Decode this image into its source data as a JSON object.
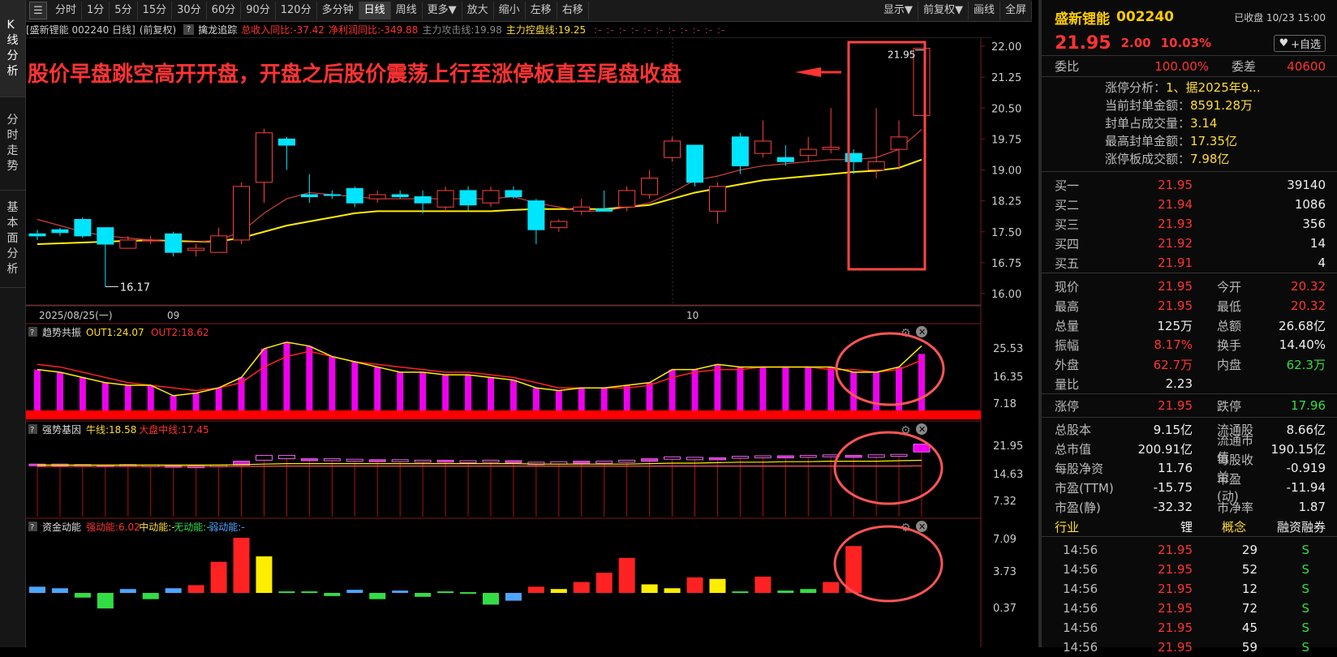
{
  "sidebar": {
    "tabs": [
      "K线分析",
      "分时走势",
      "基本面分析"
    ]
  },
  "toolbar": {
    "periods": [
      "分时",
      "1分",
      "5分",
      "15分",
      "30分",
      "60分",
      "90分",
      "120分",
      "多分钟",
      "日线",
      "周线",
      "更多▼",
      "放大",
      "缩小",
      "左移",
      "右移"
    ],
    "active_period": "日线",
    "right": [
      "显示▼",
      "前复权▼",
      "画线",
      "全屏"
    ]
  },
  "main_info": {
    "title": "[盛新锂能 002240 日线]",
    "adjust": "(前复权)",
    "indicator": "擒龙追踪",
    "items": [
      {
        "text": "总收入同比:-37.42",
        "color": "#ff3333"
      },
      {
        "text": "净利润同比:-349.88",
        "color": "#ff3333"
      },
      {
        "text": "主力攻击线:19.98",
        "color": "#888888"
      },
      {
        "text": "主力控盘线:19.25",
        "color": "#ffdd33"
      }
    ],
    "dots": ":- :- :- :- :- :- :- :- :- :- :-"
  },
  "annotation": {
    "text": "股价早盘跳空高开开盘，开盘之后股价震荡上行至涨停板直至尾盘收盘",
    "color": "#ff3333"
  },
  "price_axis": {
    "ticks": [
      "22.00",
      "21.25",
      "20.50",
      "19.75",
      "19.00",
      "18.25",
      "17.50",
      "16.75",
      "16.00"
    ]
  },
  "date_axis": {
    "labels": [
      "2025/08/25(一)",
      "09",
      "10"
    ]
  },
  "marks": {
    "high": "21.95",
    "low": "16.17"
  },
  "panels": [
    {
      "title": "趋势共振",
      "items": [
        {
          "text": "OUT1:24.07",
          "color": "#ffdd33"
        },
        {
          "text": "OUT2:18.62",
          "color": "#ff3333"
        }
      ],
      "ticks": [
        "25.53",
        "16.35",
        "7.18"
      ]
    },
    {
      "title": "强势基因",
      "items": [
        {
          "text": "牛线:18.58",
          "color": "#ffdd33"
        },
        {
          "text": "大盘中线:17.45",
          "color": "#ff3333"
        }
      ],
      "ticks": [
        "21.95",
        "14.63",
        "7.32"
      ]
    },
    {
      "title": "资金动能",
      "items": [
        {
          "text": "强动能:6.02",
          "color": "#ff3333"
        },
        {
          "text": "中动能:-",
          "color": "#ffdd33"
        },
        {
          "text": "无动能:-",
          "color": "#33dd44"
        },
        {
          "text": "弱动能:-",
          "color": "#4da6ff"
        }
      ],
      "ticks": [
        "7.09",
        "3.73",
        "0.37"
      ]
    }
  ],
  "chart_data": {
    "type": "candlestick",
    "candles": [
      [
        17.45,
        17.4,
        17.55,
        17.3
      ],
      [
        17.55,
        17.48,
        17.6,
        17.4
      ],
      [
        17.8,
        17.4,
        17.85,
        17.35
      ],
      [
        17.6,
        17.2,
        17.6,
        16.17
      ],
      [
        17.1,
        17.3,
        17.4,
        17.1
      ],
      [
        17.3,
        17.3,
        17.4,
        17.2
      ],
      [
        17.45,
        17.0,
        17.5,
        16.9
      ],
      [
        17.05,
        17.1,
        17.2,
        16.9
      ],
      [
        17.0,
        17.4,
        17.6,
        17.0
      ],
      [
        17.3,
        18.6,
        18.7,
        17.2
      ],
      [
        18.7,
        19.9,
        20.0,
        18.2
      ],
      [
        19.75,
        19.6,
        19.8,
        19.0
      ],
      [
        18.4,
        18.35,
        18.9,
        18.2
      ],
      [
        18.4,
        18.38,
        18.5,
        18.3
      ],
      [
        18.55,
        18.2,
        18.6,
        18.1
      ],
      [
        18.3,
        18.4,
        18.5,
        18.2
      ],
      [
        18.4,
        18.35,
        18.5,
        18.3
      ],
      [
        18.35,
        18.2,
        18.5,
        17.95
      ],
      [
        18.1,
        18.5,
        18.6,
        18.0
      ],
      [
        18.5,
        18.15,
        18.6,
        18.0
      ],
      [
        18.2,
        18.5,
        18.6,
        18.1
      ],
      [
        18.5,
        18.35,
        18.6,
        18.3
      ],
      [
        18.25,
        17.55,
        18.3,
        17.2
      ],
      [
        17.6,
        17.75,
        17.8,
        17.5
      ],
      [
        18.0,
        18.1,
        18.3,
        17.9
      ],
      [
        18.05,
        18.0,
        18.5,
        18.0
      ],
      [
        18.1,
        18.5,
        18.6,
        18.0
      ],
      [
        18.4,
        18.8,
        19.0,
        18.3
      ],
      [
        19.3,
        19.7,
        19.8,
        19.2
      ],
      [
        19.6,
        18.7,
        19.6,
        18.6
      ],
      [
        18.0,
        18.6,
        18.7,
        17.7
      ],
      [
        19.8,
        19.1,
        19.9,
        18.9
      ],
      [
        19.4,
        19.7,
        20.2,
        19.3
      ],
      [
        19.3,
        19.2,
        19.6,
        19.1
      ],
      [
        19.35,
        19.5,
        19.8,
        19.2
      ],
      [
        19.5,
        19.55,
        20.5,
        19.4
      ],
      [
        19.4,
        19.2,
        19.5,
        18.9
      ],
      [
        19.0,
        19.2,
        20.5,
        18.8
      ],
      [
        19.5,
        19.8,
        20.2,
        19.0
      ],
      [
        20.32,
        21.95,
        21.95,
        20.32
      ]
    ],
    "ma_short": [
      17.8,
      17.65,
      17.5,
      17.4,
      17.35,
      17.3,
      17.25,
      17.25,
      17.3,
      17.5,
      17.95,
      18.3,
      18.45,
      18.4,
      18.35,
      18.3,
      18.3,
      18.3,
      18.3,
      18.3,
      18.3,
      18.35,
      18.2,
      18.1,
      18.0,
      18.0,
      18.1,
      18.2,
      18.45,
      18.75,
      18.85,
      19.0,
      19.1,
      19.15,
      19.2,
      19.25,
      19.25,
      19.3,
      19.5,
      19.98
    ],
    "ma_long": [
      17.2,
      17.22,
      17.24,
      17.26,
      17.28,
      17.29,
      17.28,
      17.26,
      17.27,
      17.35,
      17.5,
      17.65,
      17.75,
      17.85,
      17.95,
      18.0,
      18.0,
      18.0,
      18.0,
      18.0,
      18.0,
      18.03,
      18.05,
      18.05,
      18.05,
      18.05,
      18.1,
      18.15,
      18.3,
      18.45,
      18.55,
      18.65,
      18.75,
      18.8,
      18.85,
      18.9,
      18.95,
      18.98,
      19.05,
      19.25
    ],
    "resonance_bars": [
      15,
      14,
      12,
      10,
      9,
      9,
      5,
      6,
      8,
      12,
      23,
      25.5,
      24,
      20,
      18,
      16,
      14,
      14,
      13,
      13,
      12,
      11,
      8,
      7,
      8,
      8,
      9,
      10,
      15,
      15,
      17,
      16,
      16,
      16,
      16,
      16,
      14,
      14,
      16,
      21
    ],
    "resonance_out1": [
      15,
      14,
      12,
      10,
      9,
      9,
      5,
      6,
      8,
      12,
      23,
      25.5,
      24,
      20,
      18,
      16,
      14,
      14,
      13,
      13,
      12,
      11,
      8,
      7,
      8,
      8,
      9,
      10,
      15,
      15,
      17,
      16,
      16,
      16,
      16,
      16,
      14,
      14,
      16,
      24.07
    ],
    "resonance_out2": [
      17,
      16,
      14,
      12,
      10,
      9,
      8,
      7,
      8,
      10,
      16,
      20,
      22,
      20,
      18,
      17,
      16,
      15,
      14,
      14,
      13,
      12,
      10,
      8,
      8,
      8,
      8,
      9,
      12,
      14,
      15,
      15,
      16,
      16,
      16,
      15,
      15,
      14,
      15,
      18.62
    ],
    "gene_bars": [
      [
        17.5,
        17.8
      ],
      [
        17.5,
        17.8
      ],
      [
        17.4,
        17.7
      ],
      [
        17.3,
        17.6
      ],
      [
        17.4,
        17.7
      ],
      [
        17.3,
        17.6
      ],
      [
        17.2,
        17.5
      ],
      [
        17.2,
        17.4
      ],
      [
        17.3,
        17.6
      ],
      [
        17.6,
        18.4
      ],
      [
        18.6,
        19.6
      ],
      [
        18.9,
        19.6
      ],
      [
        18.5,
        18.9
      ],
      [
        18.5,
        18.9
      ],
      [
        18.4,
        18.8
      ],
      [
        18.3,
        18.7
      ],
      [
        18.3,
        18.7
      ],
      [
        18.2,
        18.6
      ],
      [
        18.2,
        18.6
      ],
      [
        18.1,
        18.5
      ],
      [
        18.2,
        18.6
      ],
      [
        18.1,
        18.5
      ],
      [
        17.7,
        18.2
      ],
      [
        17.8,
        18.3
      ],
      [
        18.0,
        18.4
      ],
      [
        18.0,
        18.4
      ],
      [
        18.2,
        18.6
      ],
      [
        18.4,
        18.9
      ],
      [
        18.8,
        19.3
      ],
      [
        18.7,
        19.2
      ],
      [
        18.7,
        19.1
      ],
      [
        19.0,
        19.4
      ],
      [
        19.1,
        19.5
      ],
      [
        19.1,
        19.5
      ],
      [
        19.2,
        19.6
      ],
      [
        19.3,
        19.7
      ],
      [
        19.2,
        19.6
      ],
      [
        19.2,
        19.7
      ],
      [
        19.4,
        19.8
      ],
      [
        20.3,
        21.9
      ]
    ],
    "gene_line1": [
      17.6,
      17.6,
      17.6,
      17.6,
      17.6,
      17.6,
      17.6,
      17.6,
      17.6,
      17.7,
      17.8,
      17.9,
      17.9,
      17.9,
      17.9,
      17.9,
      17.9,
      17.9,
      17.9,
      17.9,
      17.9,
      17.9,
      17.8,
      17.8,
      17.8,
      17.8,
      17.8,
      17.9,
      18.0,
      18.0,
      18.1,
      18.2,
      18.2,
      18.3,
      18.3,
      18.4,
      18.4,
      18.4,
      18.5,
      18.58
    ],
    "gene_line2": [
      17.3,
      17.3,
      17.3,
      17.3,
      17.3,
      17.3,
      17.3,
      17.3,
      17.3,
      17.3,
      17.35,
      17.4,
      17.4,
      17.4,
      17.4,
      17.4,
      17.4,
      17.4,
      17.4,
      17.4,
      17.4,
      17.4,
      17.4,
      17.4,
      17.4,
      17.4,
      17.4,
      17.4,
      17.4,
      17.4,
      17.4,
      17.4,
      17.4,
      17.4,
      17.4,
      17.4,
      17.4,
      17.4,
      17.4,
      17.45
    ],
    "fund_bars": [
      [
        0.8,
        "#4da6ff"
      ],
      [
        0.6,
        "#4da6ff"
      ],
      [
        -0.6,
        "#33dd44"
      ],
      [
        -2,
        "#33dd44"
      ],
      [
        0.5,
        "#4da6ff"
      ],
      [
        -0.8,
        "#33dd44"
      ],
      [
        0.6,
        "#4da6ff"
      ],
      [
        1.0,
        "#ff2222"
      ],
      [
        4.0,
        "#ff2222"
      ],
      [
        7.09,
        "#ff2222"
      ],
      [
        4.7,
        "#ffee00"
      ],
      [
        0.2,
        "#33dd44"
      ],
      [
        0.2,
        "#33dd44"
      ],
      [
        -0.4,
        "#33dd44"
      ],
      [
        0.4,
        "#4da6ff"
      ],
      [
        -0.8,
        "#33dd44"
      ],
      [
        0.3,
        "#4da6ff"
      ],
      [
        -0.5,
        "#33dd44"
      ],
      [
        0.2,
        "#33dd44"
      ],
      [
        0.1,
        "#33dd44"
      ],
      [
        -1.5,
        "#33dd44"
      ],
      [
        -1.0,
        "#4da6ff"
      ],
      [
        0.8,
        "#ff2222"
      ],
      [
        0.5,
        "#ffee00"
      ],
      [
        1.4,
        "#ff2222"
      ],
      [
        2.6,
        "#ff2222"
      ],
      [
        4.5,
        "#ff2222"
      ],
      [
        1.1,
        "#ffee00"
      ],
      [
        0.6,
        "#ffee00"
      ],
      [
        2.0,
        "#ff2222"
      ],
      [
        1.8,
        "#ffee00"
      ],
      [
        0.2,
        "#33dd44"
      ],
      [
        2.1,
        "#ff2222"
      ],
      [
        0.3,
        "#33dd44"
      ],
      [
        0.5,
        "#33dd44"
      ],
      [
        1.4,
        "#ff2222"
      ],
      [
        6.02,
        "#ff2222"
      ]
    ]
  },
  "stock": {
    "name": "盛新锂能",
    "code": "002240",
    "status": "已收盘 10/23 15:00",
    "price": "21.95",
    "change": "2.00",
    "pct": "10.03%",
    "fav": "+自选"
  },
  "weibi": {
    "l1": "委比",
    "v1": "100.00%",
    "l2": "委差",
    "v2": "40600"
  },
  "limit_info": [
    {
      "label": "涨停分析：",
      "value": "1、据2025年9..."
    },
    {
      "label": "当前封单金额：",
      "value": "8591.28万"
    },
    {
      "label": "封单占成交量：",
      "value": "3.14"
    },
    {
      "label": "最高封单金额：",
      "value": "17.35亿"
    },
    {
      "label": "涨停板成交额：",
      "value": "7.98亿"
    }
  ],
  "buy_orders": [
    {
      "label": "买一",
      "price": "21.95",
      "vol": "39140"
    },
    {
      "label": "买二",
      "price": "21.94",
      "vol": "1086"
    },
    {
      "label": "买三",
      "price": "21.93",
      "vol": "356"
    },
    {
      "label": "买四",
      "price": "21.92",
      "vol": "14"
    },
    {
      "label": "买五",
      "price": "21.91",
      "vol": "4"
    }
  ],
  "quote_rows": [
    {
      "l1": "现价",
      "v1": "21.95",
      "c1": "red",
      "l2": "今开",
      "v2": "20.32",
      "c2": "red"
    },
    {
      "l1": "最高",
      "v1": "21.95",
      "c1": "red",
      "l2": "最低",
      "v2": "20.32",
      "c2": "red"
    },
    {
      "l1": "总量",
      "v1": "125万",
      "c1": "white",
      "l2": "总额",
      "v2": "26.68亿",
      "c2": "white"
    },
    {
      "l1": "振幅",
      "v1": "8.17%",
      "c1": "red",
      "l2": "换手",
      "v2": "14.40%",
      "c2": "white"
    },
    {
      "l1": "外盘",
      "v1": "62.7万",
      "c1": "red",
      "l2": "内盘",
      "v2": "62.3万",
      "c2": "green"
    },
    {
      "l1": "量比",
      "v1": "2.23",
      "c1": "white",
      "l2": "",
      "v2": "",
      "c2": "white"
    }
  ],
  "limit_rows": [
    {
      "l1": "涨停",
      "v1": "21.95",
      "c1": "red",
      "l2": "跌停",
      "v2": "17.96",
      "c2": "green"
    }
  ],
  "fund_rows": [
    {
      "l1": "总股本",
      "v1": "9.15亿",
      "c1": "white",
      "l2": "流通股",
      "v2": "8.66亿",
      "c2": "white"
    },
    {
      "l1": "总市值",
      "v1": "200.91亿",
      "c1": "white",
      "l2": "流通市值",
      "v2": "190.15亿",
      "c2": "white"
    },
    {
      "l1": "每股净资",
      "v1": "11.76",
      "c1": "white",
      "l2": "每股收益",
      "v2": "-0.919",
      "c2": "white"
    },
    {
      "l1": "市盈(TTM)",
      "v1": "-15.75",
      "c1": "white",
      "l2": "市盈(动)",
      "v2": "-11.94",
      "c2": "white"
    },
    {
      "l1": "市盈(静)",
      "v1": "-32.32",
      "c1": "white",
      "l2": "市净率",
      "v2": "1.87",
      "c2": "white"
    }
  ],
  "tabs_row": {
    "t1": "行业",
    "t2": "锂",
    "t3": "概念",
    "t4": "融资融券"
  },
  "ticks": [
    {
      "time": "14:56",
      "price": "21.95",
      "vol": "29",
      "side": "S"
    },
    {
      "time": "14:56",
      "price": "21.95",
      "vol": "52",
      "side": "S"
    },
    {
      "time": "14:56",
      "price": "21.95",
      "vol": "12",
      "side": "S"
    },
    {
      "time": "14:56",
      "price": "21.95",
      "vol": "72",
      "side": "S"
    },
    {
      "time": "14:56",
      "price": "21.95",
      "vol": "45",
      "side": "S"
    },
    {
      "time": "14:56",
      "price": "21.95",
      "vol": "59",
      "side": "S"
    }
  ]
}
